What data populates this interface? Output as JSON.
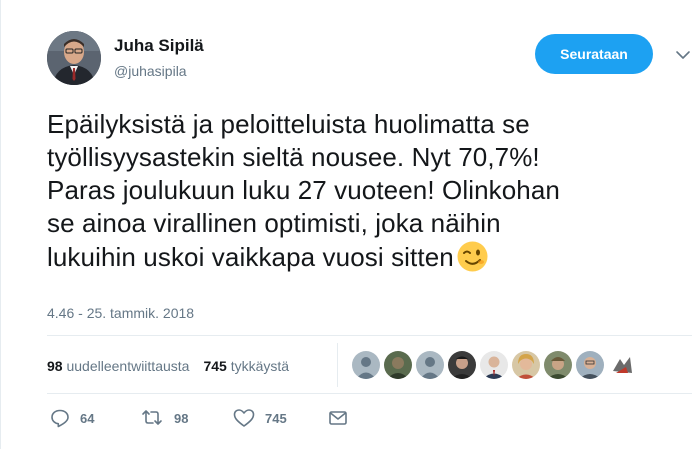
{
  "author": {
    "name": "Juha Sipilä",
    "handle": "@juhasipila",
    "follow_label": "Seurataan"
  },
  "tweet": {
    "lines": [
      "Epäilyksistä ja peloitteluista huolimatta se",
      "työllisyysastekin sieltä nousee. Nyt 70,7%!",
      "Paras joulukuun luku 27 vuoteen! Olinkohan",
      "se ainoa virallinen optimisti, joka näihin",
      "lukuihin uskoi vaikkapa vuosi sitten"
    ],
    "emoji": "winking-face"
  },
  "timestamp": "4.46 - 25. tammik. 2018",
  "stats": {
    "retweets_count": "98",
    "retweets_label": "uudelleentwiittausta",
    "likes_count": "745",
    "likes_label": "tykkäystä"
  },
  "actions": {
    "reply_count": "64",
    "retweet_count": "98",
    "like_count": "745"
  },
  "colors": {
    "accent": "#1da1f2",
    "secondary_text": "#657786",
    "divider": "#e6ecf0"
  }
}
